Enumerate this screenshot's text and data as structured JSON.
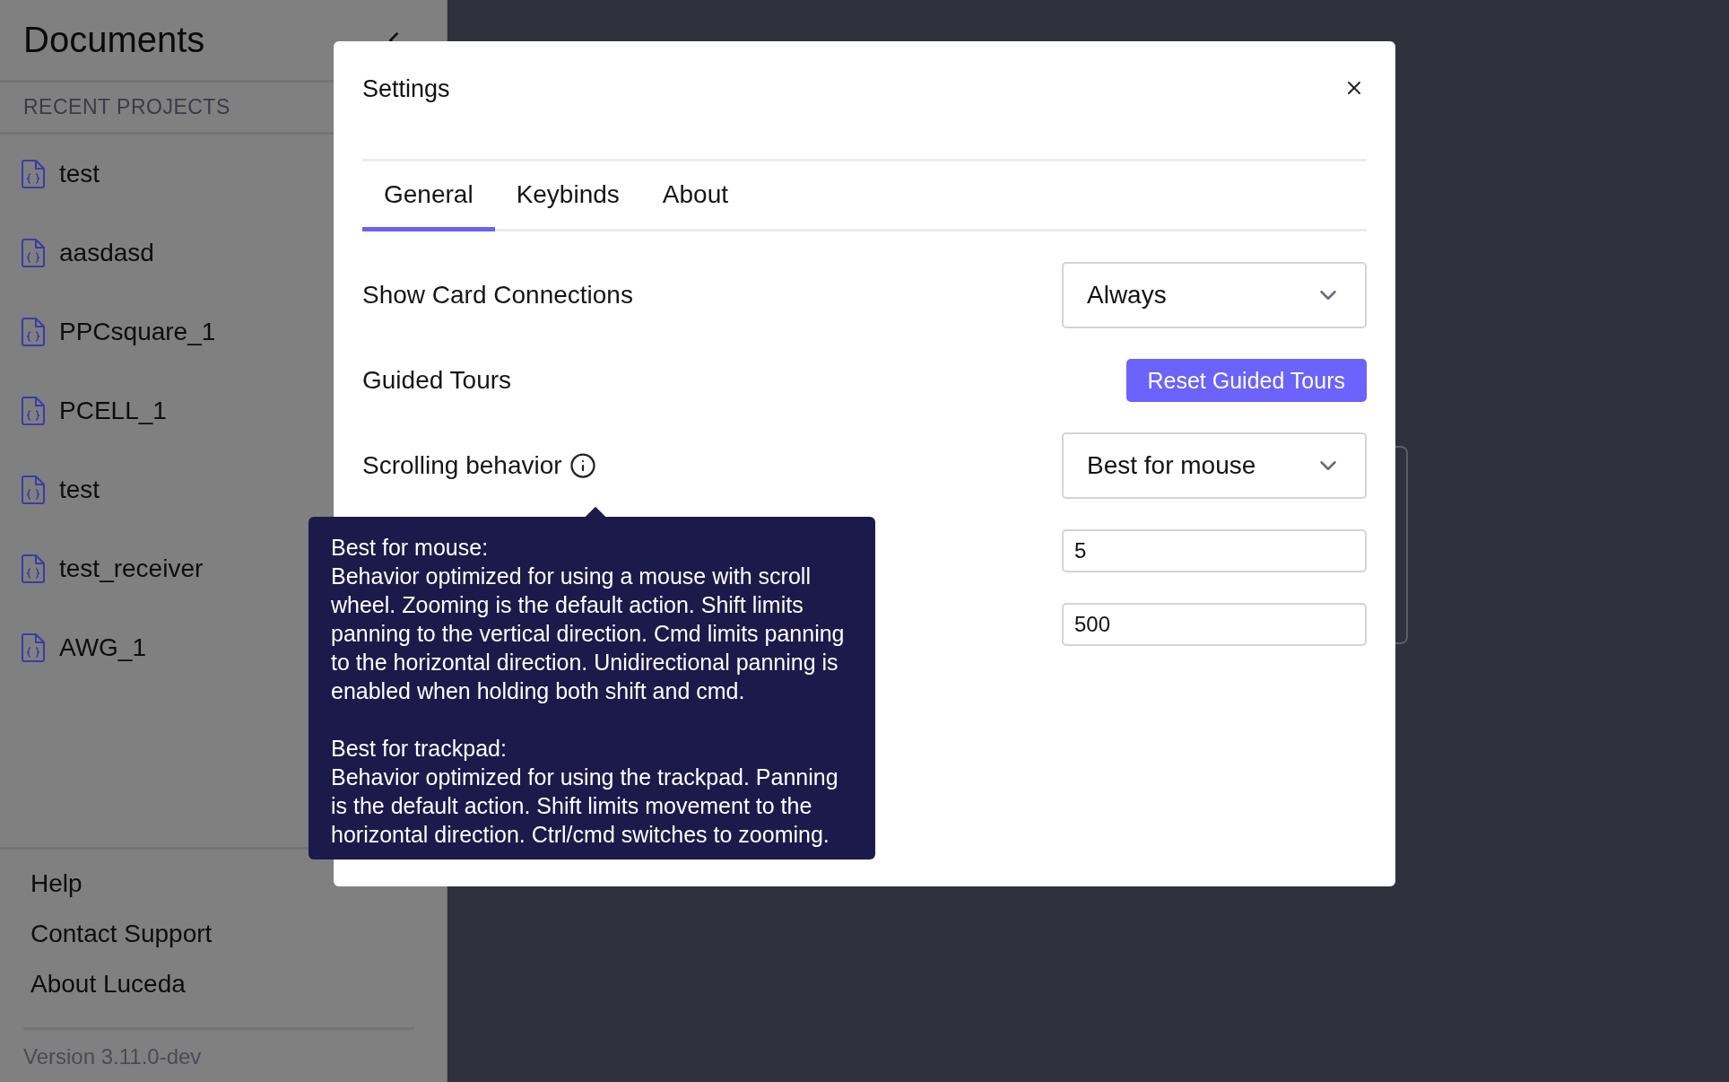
{
  "sidebar": {
    "title": "Documents",
    "section_label": "RECENT PROJECTS",
    "projects": [
      {
        "name": "test"
      },
      {
        "name": "aasdasd"
      },
      {
        "name": "PPCsquare_1"
      },
      {
        "name": "PCELL_1"
      },
      {
        "name": "test"
      },
      {
        "name": "test_receiver"
      },
      {
        "name": "AWG_1"
      }
    ],
    "footer_links": [
      "Help",
      "Contact Support",
      "About Luceda"
    ],
    "version": "Version 3.11.0-dev"
  },
  "dialog": {
    "title": "Settings",
    "tabs": [
      {
        "label": "General",
        "selected": true
      },
      {
        "label": "Keybinds",
        "selected": false
      },
      {
        "label": "About",
        "selected": false
      }
    ],
    "settings": [
      {
        "kind": "select",
        "label": "Show Card Connections",
        "value": "Always",
        "info": false
      },
      {
        "kind": "button",
        "label": "Guided Tours",
        "button": "Reset Guided Tours",
        "info": false
      },
      {
        "kind": "select",
        "label": "Scrolling behavior",
        "value": "Best for mouse",
        "info": true
      },
      {
        "kind": "input",
        "value": "5"
      },
      {
        "kind": "input",
        "value": "500"
      }
    ],
    "tooltip": [
      {
        "heading": "Best for mouse:",
        "body": "Behavior optimized for using a mouse with scroll wheel. Zooming is the default action. Shift limits panning to the vertical direction. Cmd limits panning to the horizontal direction. Unidirectional panning is enabled when holding both shift and cmd."
      },
      {
        "heading": "Best for trackpad:",
        "body": "Behavior optimized for using the trackpad. Panning is the default action. Shift limits movement to the horizontal direction. Ctrl/cmd switches to zooming."
      }
    ]
  }
}
